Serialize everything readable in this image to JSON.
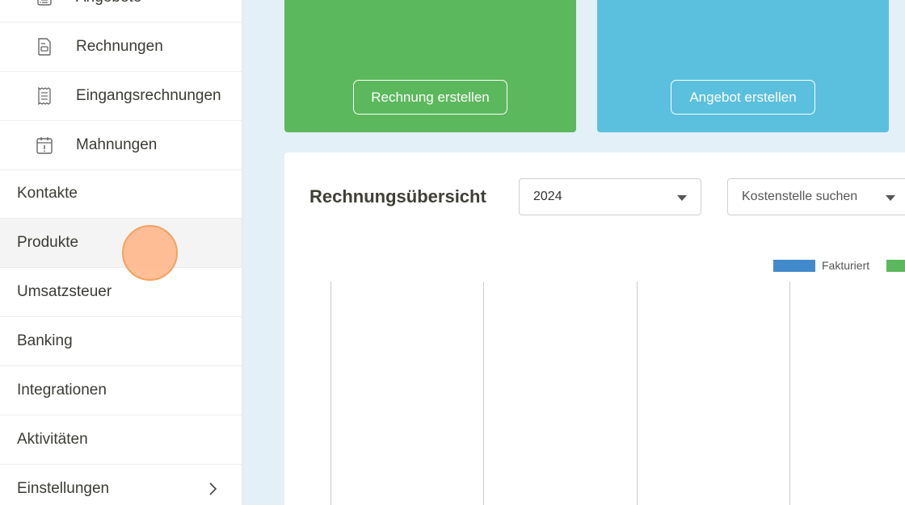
{
  "sidebar": {
    "sub_items": [
      {
        "label": "Angebote",
        "icon": "offer-list-icon"
      },
      {
        "label": "Rechnungen",
        "icon": "invoice-document-icon"
      },
      {
        "label": "Eingangsrechnungen",
        "icon": "receipt-icon"
      },
      {
        "label": "Mahnungen",
        "icon": "calendar-alert-icon"
      }
    ],
    "items": [
      {
        "label": "Kontakte"
      },
      {
        "label": "Produkte"
      },
      {
        "label": "Umsatzsteuer"
      },
      {
        "label": "Banking"
      },
      {
        "label": "Integrationen"
      },
      {
        "label": "Aktivitäten"
      },
      {
        "label": "Einstellungen",
        "icon": "chevron-right-icon"
      }
    ]
  },
  "cards": {
    "invoice": {
      "button_label": "Rechnung erstellen",
      "color": "#5cb85c"
    },
    "offer": {
      "button_label": "Angebot erstellen",
      "color": "#5bc0de"
    }
  },
  "panel": {
    "title": "Rechnungsübersicht",
    "year_select": {
      "value": "2024"
    },
    "cost_center_select": {
      "placeholder": "Kostenstelle suchen"
    }
  },
  "chart_data": {
    "type": "bar",
    "legend": [
      {
        "name": "Fakturiert",
        "color": "#428bca"
      },
      {
        "name": "",
        "color": "#5cb85c"
      }
    ],
    "grid": true
  }
}
